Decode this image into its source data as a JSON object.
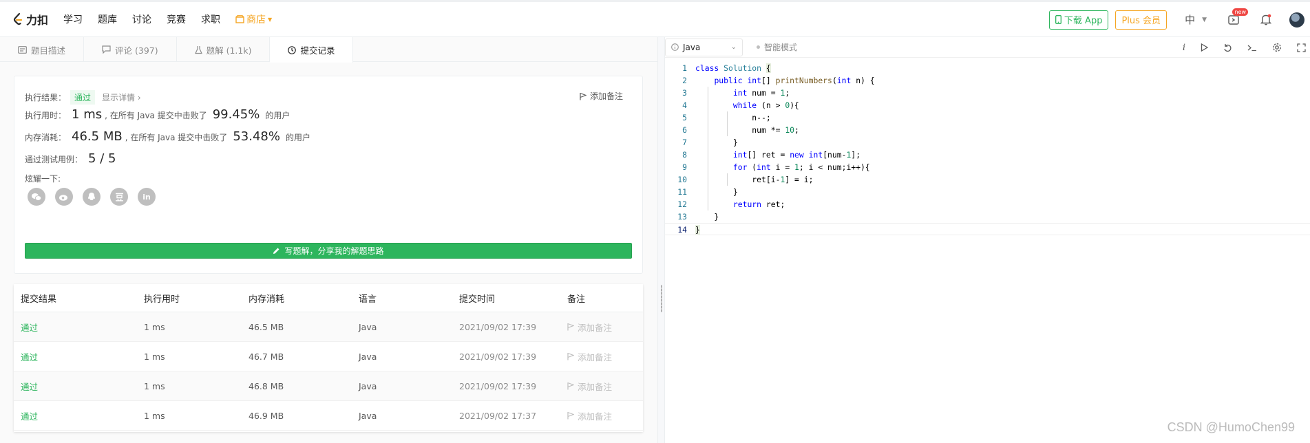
{
  "brand": {
    "name": "力扣"
  },
  "nav": {
    "items": [
      "学习",
      "题库",
      "讨论",
      "竞赛",
      "求职"
    ],
    "shop": "商店"
  },
  "header_right": {
    "download": "下载 App",
    "plus": "Plus 会员",
    "language": "中",
    "new_badge": "new"
  },
  "tabs": [
    {
      "label": "题目描述",
      "icon": "description-icon"
    },
    {
      "label": "评论 (397)",
      "icon": "comment-icon"
    },
    {
      "label": "题解 (1.1k)",
      "icon": "flask-icon"
    },
    {
      "label": "提交记录",
      "icon": "clock-icon"
    }
  ],
  "result": {
    "status_label": "执行结果：",
    "status": "通过",
    "detail_link": "显示详情 ›",
    "add_note": "添加备注",
    "runtime_label": "执行用时：",
    "runtime": "1 ms",
    "runtime_text_a": ", 在所有 Java 提交中击败了",
    "runtime_pct": "99.45%",
    "runtime_text_b": "的用户",
    "memory_label": "内存消耗：",
    "memory": "46.5 MB",
    "memory_text_a": ", 在所有 Java 提交中击败了",
    "memory_pct": "53.48%",
    "memory_text_b": "的用户",
    "tests_label": "通过测试用例：",
    "tests": "5 / 5",
    "share_label": "炫耀一下:",
    "share_icons": [
      "wechat-icon",
      "weibo-icon",
      "qq-icon",
      "douban-icon",
      "linkedin-icon"
    ],
    "write_button": "写题解，分享我的解题思路"
  },
  "submissions": {
    "headers": [
      "提交结果",
      "执行用时",
      "内存消耗",
      "语言",
      "提交时间",
      "备注"
    ],
    "rows": [
      {
        "result": "通过",
        "runtime": "1 ms",
        "memory": "46.5 MB",
        "lang": "Java",
        "time": "2021/09/02 17:39",
        "note": "添加备注"
      },
      {
        "result": "通过",
        "runtime": "1 ms",
        "memory": "46.7 MB",
        "lang": "Java",
        "time": "2021/09/02 17:39",
        "note": "添加备注"
      },
      {
        "result": "通过",
        "runtime": "1 ms",
        "memory": "46.8 MB",
        "lang": "Java",
        "time": "2021/09/02 17:39",
        "note": "添加备注"
      },
      {
        "result": "通过",
        "runtime": "1 ms",
        "memory": "46.9 MB",
        "lang": "Java",
        "time": "2021/09/02 17:37",
        "note": "添加备注"
      }
    ]
  },
  "editor": {
    "language": "Java",
    "smart_mode": "智能模式",
    "toolbar_icons": [
      "info-icon",
      "run-icon",
      "reset-icon",
      "console-icon",
      "settings-icon",
      "fullscreen-icon"
    ]
  },
  "watermark": "CSDN @HumoChen99"
}
